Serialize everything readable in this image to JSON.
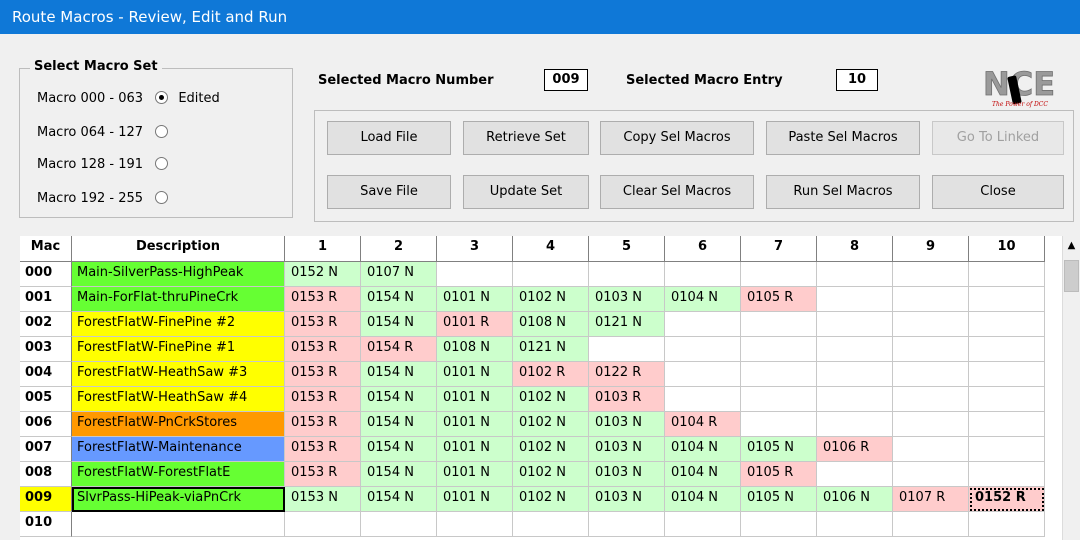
{
  "window": {
    "title": "Route Macros - Review, Edit and Run"
  },
  "macro_set": {
    "legend": "Select Macro Set",
    "options": [
      {
        "label": "Macro 000 - 063",
        "checked": true,
        "suffix": "Edited"
      },
      {
        "label": "Macro 064 - 127",
        "checked": false,
        "suffix": ""
      },
      {
        "label": "Macro 128 - 191",
        "checked": false,
        "suffix": ""
      },
      {
        "label": "Macro 192 - 255",
        "checked": false,
        "suffix": ""
      }
    ]
  },
  "selection": {
    "macro_number_label": "Selected Macro Number",
    "macro_number": "009",
    "macro_entry_label": "Selected Macro Entry",
    "macro_entry": "10"
  },
  "logo": {
    "text": "NCE",
    "tagline": "The Power of DCC"
  },
  "buttons": {
    "load_file": "Load File",
    "retrieve_set": "Retrieve Set",
    "copy_sel": "Copy Sel Macros",
    "paste_sel": "Paste Sel Macros",
    "go_linked": "Go To Linked",
    "save_file": "Save File",
    "update_set": "Update Set",
    "clear_sel": "Clear Sel Macros",
    "run_sel": "Run Sel Macros",
    "close": "Close"
  },
  "grid": {
    "headers": [
      "Mac",
      "Description",
      "1",
      "2",
      "3",
      "4",
      "5",
      "6",
      "7",
      "8",
      "9",
      "10"
    ],
    "rows": [
      {
        "mac": "000",
        "desc": "Main-SilverPass-HighPeak",
        "desc_color": "#66ff33",
        "cells": [
          "0152 N",
          "0107 N",
          "",
          "",
          "",
          "",
          "",
          "",
          "",
          ""
        ]
      },
      {
        "mac": "001",
        "desc": "Main-ForFlat-thruPineCrk",
        "desc_color": "#66ff33",
        "cells": [
          "0153 R",
          "0154 N",
          "0101 N",
          "0102 N",
          "0103 N",
          "0104 N",
          "0105 R",
          "",
          "",
          ""
        ]
      },
      {
        "mac": "002",
        "desc": "ForestFlatW-FinePine #2",
        "desc_color": "#ffff00",
        "cells": [
          "0153 R",
          "0154 N",
          "0101 R",
          "0108 N",
          "0121 N",
          "",
          "",
          "",
          "",
          ""
        ]
      },
      {
        "mac": "003",
        "desc": "ForestFlatW-FinePine #1",
        "desc_color": "#ffff00",
        "cells": [
          "0153 R",
          "0154 R",
          "0108 N",
          "0121 N",
          "",
          "",
          "",
          "",
          "",
          ""
        ]
      },
      {
        "mac": "004",
        "desc": "ForestFlatW-HeathSaw #3",
        "desc_color": "#ffff00",
        "cells": [
          "0153 R",
          "0154 N",
          "0101 N",
          "0102 R",
          "0122 R",
          "",
          "",
          "",
          "",
          ""
        ]
      },
      {
        "mac": "005",
        "desc": "ForestFlatW-HeathSaw #4",
        "desc_color": "#ffff00",
        "cells": [
          "0153 R",
          "0154 N",
          "0101 N",
          "0102 N",
          "0103 R",
          "",
          "",
          "",
          "",
          ""
        ]
      },
      {
        "mac": "006",
        "desc": "ForestFlatW-PnCrkStores",
        "desc_color": "#ff9900",
        "cells": [
          "0153 R",
          "0154 N",
          "0101 N",
          "0102 N",
          "0103 N",
          "0104 R",
          "",
          "",
          "",
          ""
        ]
      },
      {
        "mac": "007",
        "desc": "ForestFlatW-Maintenance",
        "desc_color": "#6699ff",
        "cells": [
          "0153 R",
          "0154 N",
          "0101 N",
          "0102 N",
          "0103 N",
          "0104 N",
          "0105 N",
          "0106 R",
          "",
          ""
        ]
      },
      {
        "mac": "008",
        "desc": "ForestFlatW-ForestFlatE",
        "desc_color": "#66ff33",
        "cells": [
          "0153 R",
          "0154 N",
          "0101 N",
          "0102 N",
          "0103 N",
          "0104 N",
          "0105 R",
          "",
          "",
          ""
        ]
      },
      {
        "mac": "009",
        "desc": "SlvrPass-HiPeak-viaPnCrk",
        "desc_color": "#66ff33",
        "cells": [
          "0153 N",
          "0154 N",
          "0101 N",
          "0102 N",
          "0103 N",
          "0104 N",
          "0105 N",
          "0106 N",
          "0107 R",
          "0152 R"
        ],
        "selected": true
      },
      {
        "mac": "010",
        "desc": "",
        "desc_color": "#ffffff",
        "cells": [
          "",
          "",
          "",
          "",
          "",
          "",
          "",
          "",
          "",
          ""
        ]
      }
    ]
  },
  "colors": {
    "titlebar": "#0f78d7",
    "normal_cell": "#ccffcc",
    "reversed_cell": "#ffcccc",
    "selected_mac": "#ffff00"
  }
}
